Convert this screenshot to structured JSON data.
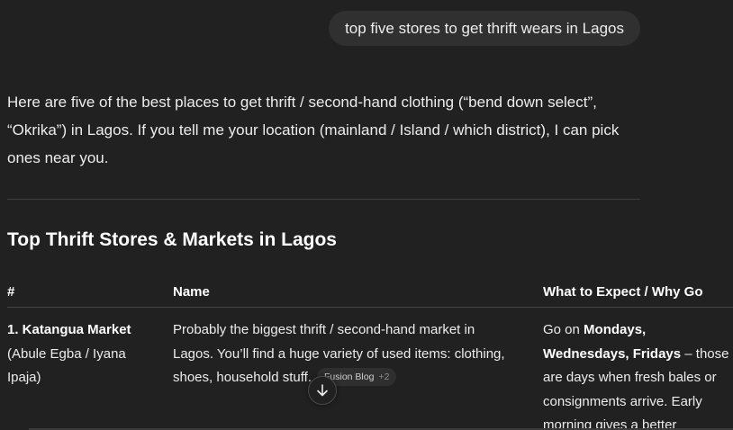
{
  "user_message": "top five stores to get thrift wears in Lagos",
  "intro": "Here are five of the best places to get thrift / second-hand clothing (“bend down select”, “Okrika”) in Lagos. If you tell me your location (mainland / Island / which district), I can pick ones near you.",
  "heading": "Top Thrift Stores & Markets in Lagos",
  "table": {
    "headers": [
      "#",
      "Name",
      "What to Expect / Why Go"
    ],
    "rows": [
      {
        "number_name": "1. Katangua Market",
        "location": "(Abule Egba / Iyana Ipaja)",
        "description": "Probably the biggest thrift / second-hand market in Lagos. You’ll find a huge variety of used items: clothing, shoes, household stuff.",
        "source": {
          "label": "Fusion Blog",
          "more": "+2"
        },
        "why_prefix": "Go on ",
        "why_days": "Mondays, Wednesdays, Fridays",
        "why_suffix": " – those are days when fresh bales or consignments arrive. Early morning gives a better"
      }
    ]
  },
  "icons": {
    "scroll_down": "arrow-down-icon"
  }
}
